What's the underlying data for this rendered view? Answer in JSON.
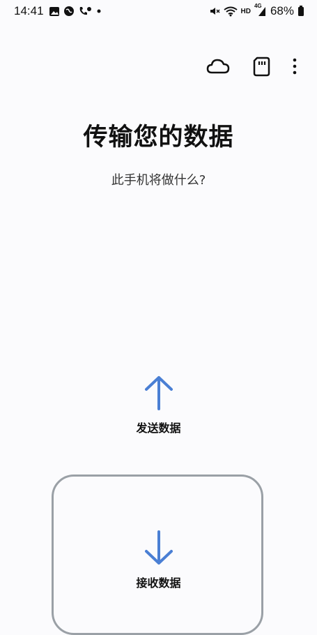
{
  "status_bar": {
    "time": "14:41",
    "left_icons": [
      "image-icon",
      "globe-icon",
      "phone-location-icon",
      "dot-icon"
    ],
    "right_icons": [
      "mute-icon",
      "wifi-icon",
      "hd-badge",
      "4g-signal-icon",
      "battery-icon"
    ],
    "hd_label": "HD",
    "network_label": "4G",
    "battery": "68%"
  },
  "toolbar": {
    "icons": [
      "cloud-icon",
      "sd-card-icon",
      "more-options-icon"
    ]
  },
  "main": {
    "title": "传输您的数据",
    "subtitle": "此手机将做什么?",
    "send_label": "发送数据",
    "receive_label": "接收数据"
  },
  "colors": {
    "accent": "#4a7fd4",
    "card_border": "#9aa0a6",
    "background": "#fbfbfd"
  }
}
